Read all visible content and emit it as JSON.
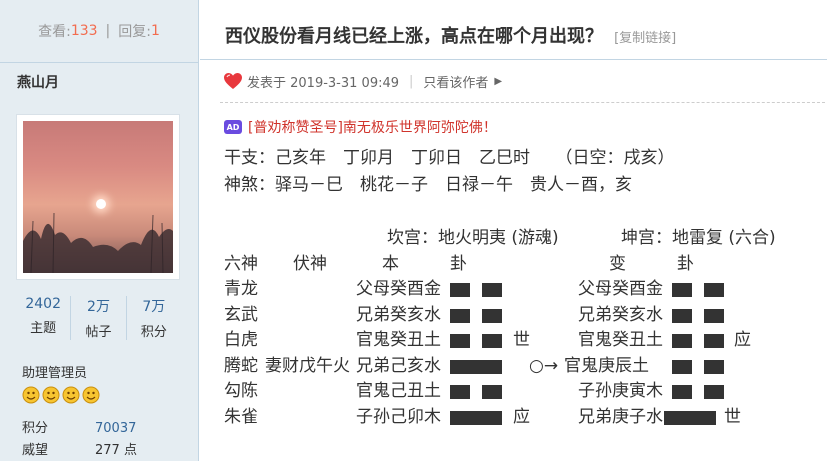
{
  "sidebar": {
    "views_label": "查看:",
    "views": "133",
    "replies_label": "回复:",
    "replies": "1",
    "username": "燕山月",
    "counts": [
      {
        "value": "2402",
        "label": "主题"
      },
      {
        "value": "2万",
        "label": "帖子"
      },
      {
        "value": "7万",
        "label": "积分"
      }
    ],
    "role": "助理管理员",
    "info": [
      {
        "key": "积分",
        "value": "70037"
      },
      {
        "key": "威望",
        "value": "277 点"
      }
    ]
  },
  "post": {
    "title": "西仪股份看月线已经上涨，高点在哪个月出现？",
    "copy_link": "[复制链接]",
    "posted_label": "发表于 2019-3-31 09:49",
    "only_author": "只看该作者",
    "ad_badge": "AD",
    "ad_text": "[普劝称赞圣号]南无极乐世界阿弥陀佛！"
  },
  "reading": {
    "ganzhi": "干支：己亥年　丁卯月　丁卯日　乙巳时　　（日空：戌亥）",
    "shensha": "神煞：驿马－巳　桃花－子　日禄－午　贵人－酉，亥",
    "palace_main": "坎宫：地火明夷 (游魂)",
    "palace_change": "坤宫：地雷复 (六合)",
    "header_liushen": "六神",
    "header_fushen": "伏神",
    "header_ben": "本　　　卦",
    "header_bian": "变　　　卦",
    "rows": [
      {
        "liushen": "青龙",
        "fushen": "",
        "ben": "父母癸酉金",
        "ben_line": "yin",
        "shi": "",
        "bian": "父母癸酉金",
        "bian_line": "yin",
        "ying": ""
      },
      {
        "liushen": "玄武",
        "fushen": "",
        "ben": "兄弟癸亥水",
        "ben_line": "yin",
        "shi": "",
        "bian": "兄弟癸亥水",
        "bian_line": "yin",
        "ying": ""
      },
      {
        "liushen": "白虎",
        "fushen": "",
        "ben": "官鬼癸丑土",
        "ben_line": "yin",
        "shi": "世",
        "bian": "官鬼癸丑土",
        "bian_line": "yin",
        "ying": "应"
      },
      {
        "liushen": "腾蛇",
        "fushen": "妻财戊午火",
        "ben": "兄弟己亥水",
        "ben_line": "yang",
        "shi": "",
        "bian": "官鬼庚辰土",
        "bian_line": "yin",
        "ying": "",
        "moving": "○→"
      },
      {
        "liushen": "勾陈",
        "fushen": "",
        "ben": "官鬼己丑土",
        "ben_line": "yin",
        "shi": "",
        "bian": "子孙庚寅木",
        "bian_line": "yin",
        "ying": ""
      },
      {
        "liushen": "朱雀",
        "fushen": "",
        "ben": "子孙己卯木",
        "ben_line": "yang",
        "shi": "应",
        "bian": "兄弟庚子水",
        "bian_line": "yang",
        "ying": "世"
      }
    ]
  },
  "colors": {
    "accent_number": "#f26c4f",
    "link": "#336699",
    "sidebar_bg": "#e5edf2",
    "ad_text": "#d0342c"
  }
}
